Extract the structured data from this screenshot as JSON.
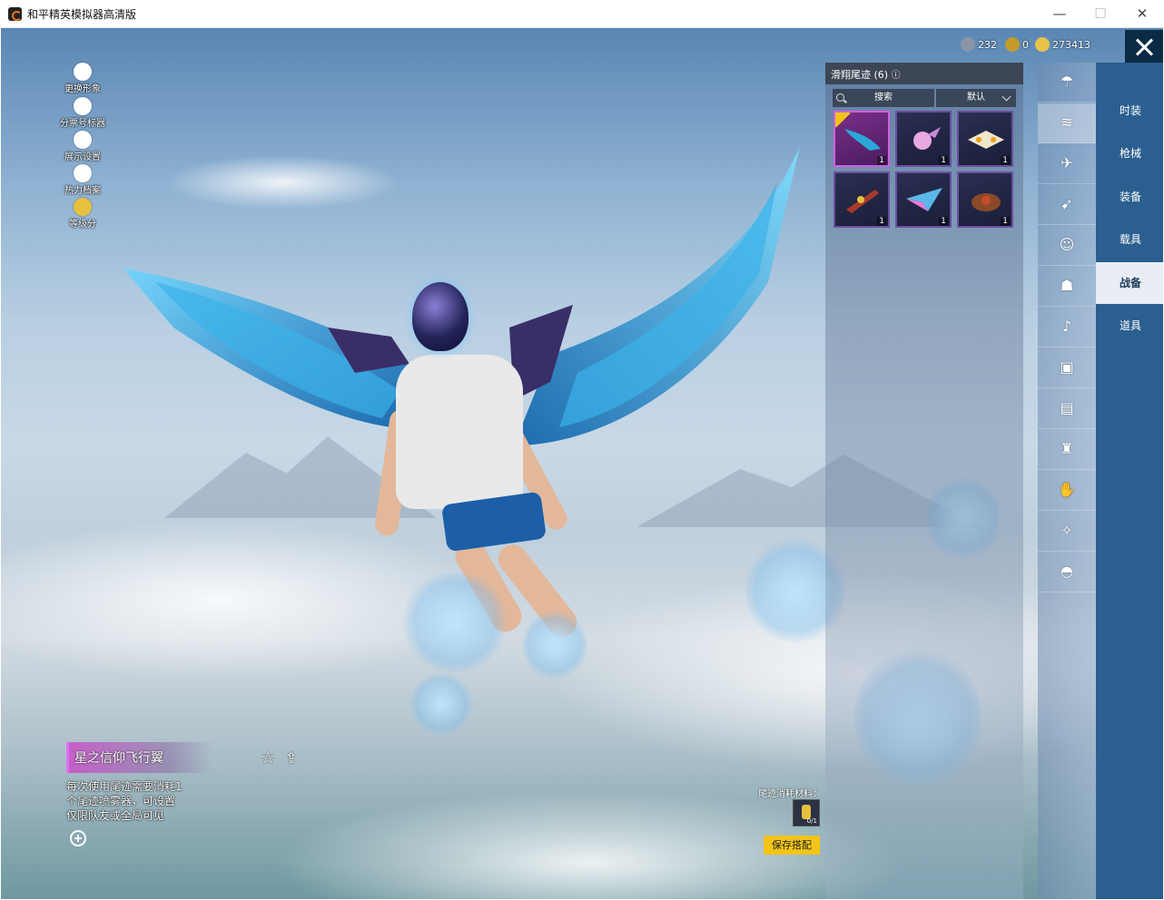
{
  "window": {
    "title": "和平精英模拟器高清版",
    "minimize": "—",
    "maximize": "☐",
    "close": "✕"
  },
  "side_menu": [
    {
      "label": "更换形象",
      "icon": "person-icon"
    },
    {
      "label": "分票号标器",
      "icon": "settings-icon"
    },
    {
      "label": "展示设置",
      "icon": "eye-icon"
    },
    {
      "label": "热力档案",
      "icon": "flame-icon"
    },
    {
      "label": "等级分",
      "icon": "badge-icon"
    }
  ],
  "currency": [
    {
      "value": "232",
      "color": "#8c95a8",
      "icon": "gem-icon"
    },
    {
      "value": "0",
      "color": "#c49a2c",
      "icon": "token-icon"
    },
    {
      "value": "273413",
      "color": "#e8c34a",
      "icon": "coin-icon"
    }
  ],
  "panel": {
    "title": "滑翔尾迹 (6)",
    "info_icon": "ⓘ",
    "search_placeholder": "搜索",
    "sort_label": "默认",
    "items": [
      {
        "count": "1",
        "selected": true,
        "color": "#2aa8d8"
      },
      {
        "count": "1",
        "selected": false,
        "color": "#e8a8e0"
      },
      {
        "count": "1",
        "selected": false,
        "color": "#f0e6c8"
      },
      {
        "count": "1",
        "selected": false,
        "color": "#a83a2a"
      },
      {
        "count": "1",
        "selected": false,
        "color": "#5ab8e8"
      },
      {
        "count": "1",
        "selected": false,
        "color": "#8a4a2a"
      }
    ]
  },
  "icon_column": [
    {
      "icon": "parachute-icon",
      "glyph": "☂",
      "active": false
    },
    {
      "icon": "wing-trail-icon",
      "glyph": "≋",
      "active": true
    },
    {
      "icon": "drone-icon",
      "glyph": "✈",
      "active": false
    },
    {
      "icon": "plane-icon",
      "glyph": "➹",
      "active": false
    },
    {
      "icon": "emote-icon",
      "glyph": "☺",
      "active": false
    },
    {
      "icon": "pet-icon",
      "glyph": "☗",
      "active": false
    },
    {
      "icon": "sound-icon",
      "glyph": "♪",
      "active": false
    },
    {
      "icon": "card-icon",
      "glyph": "▣",
      "active": false
    },
    {
      "icon": "picture-icon",
      "glyph": "▤",
      "active": false
    },
    {
      "icon": "extinguisher-icon",
      "glyph": "♜",
      "active": false
    },
    {
      "icon": "hand-icon",
      "glyph": "✋",
      "active": false
    },
    {
      "icon": "wand-icon",
      "glyph": "✧",
      "active": false
    },
    {
      "icon": "helmet-icon",
      "glyph": "◓",
      "active": false
    }
  ],
  "categories": [
    {
      "label": "时装",
      "active": false
    },
    {
      "label": "枪械",
      "active": false
    },
    {
      "label": "装备",
      "active": false
    },
    {
      "label": "载具",
      "active": false
    },
    {
      "label": "战备",
      "active": true
    },
    {
      "label": "道具",
      "active": false
    }
  ],
  "item_info": {
    "name": "星之信仰飞行翼",
    "description": [
      "每次使用尾迹需要消耗1",
      "个尾迹喷雾器，可设置",
      "仅限队友或全局可见"
    ]
  },
  "material": {
    "label": "尾迹消耗材料：",
    "count": "0/1",
    "save_label": "保存搭配"
  },
  "colors": {
    "accent_yellow": "#f2c418",
    "category_bg": "#2a5f8f",
    "item_border": "#6b4fa2"
  }
}
